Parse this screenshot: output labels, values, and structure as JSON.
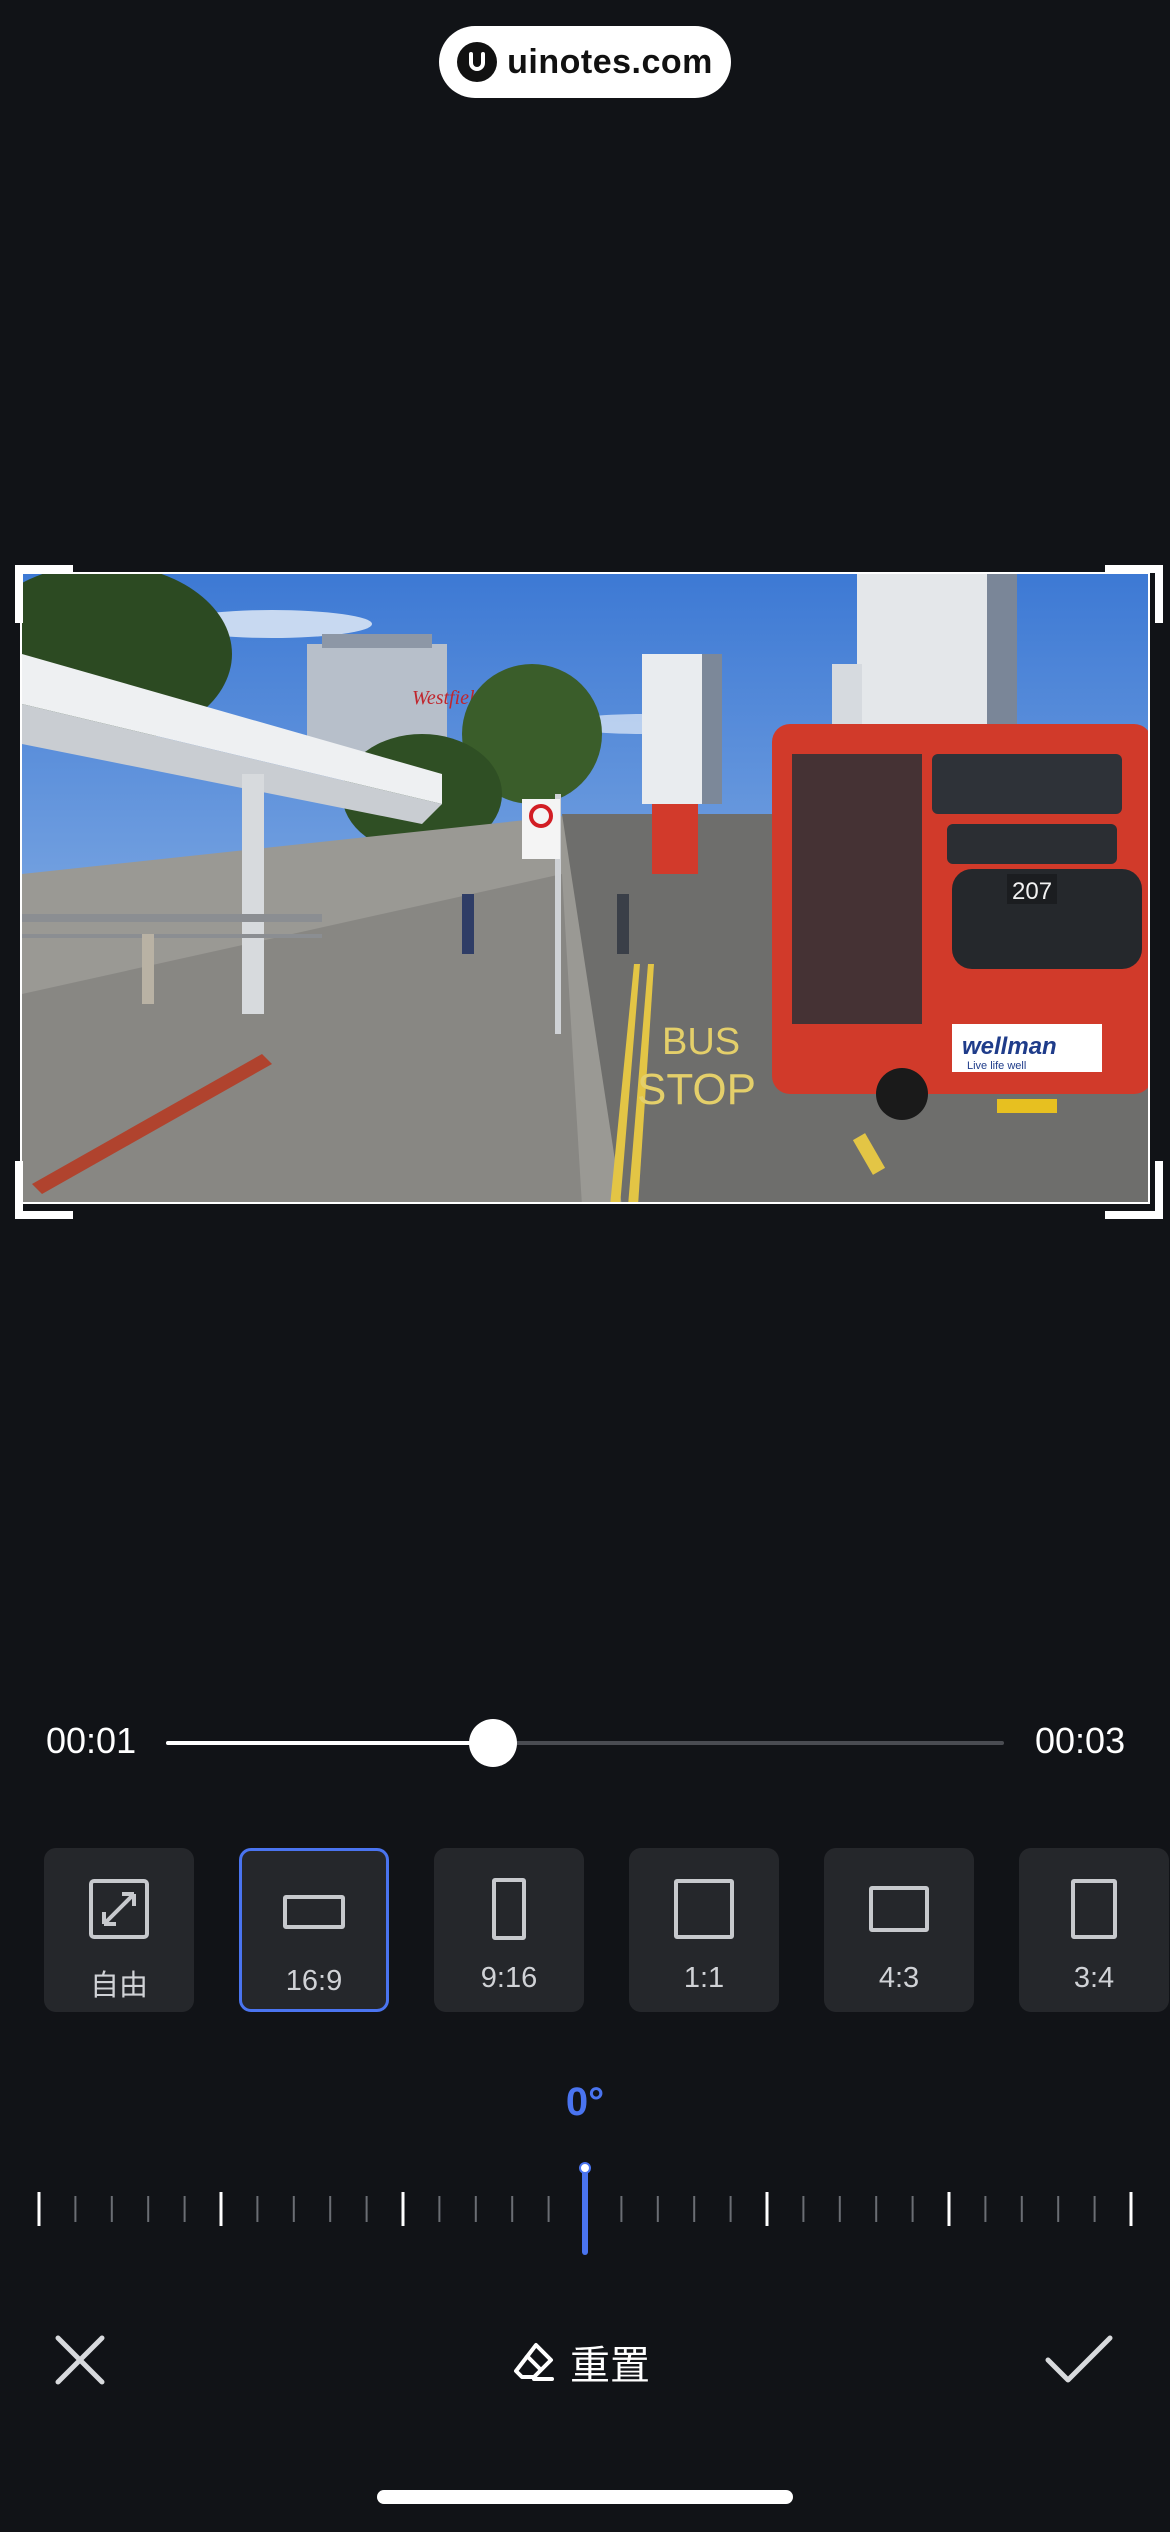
{
  "watermark": {
    "text": "uinotes.com"
  },
  "preview": {
    "bus_route": "207",
    "ad_brand": "wellman",
    "ad_tagline": "Live life well",
    "road_text_1": "BUS",
    "road_text_2": "STOP",
    "building_sign": "Westfield"
  },
  "timeline": {
    "start": "00:01",
    "end": "00:03",
    "progress": 0.39
  },
  "ratios": [
    {
      "label": "自由",
      "icon": "free-crop-icon"
    },
    {
      "label": "16:9",
      "icon": "ratio-16-9-icon",
      "selected": true
    },
    {
      "label": "9:16",
      "icon": "ratio-9-16-icon"
    },
    {
      "label": "1:1",
      "icon": "ratio-1-1-icon"
    },
    {
      "label": "4:3",
      "icon": "ratio-4-3-icon"
    },
    {
      "label": "3:4",
      "icon": "ratio-3-4-icon"
    }
  ],
  "rotation": {
    "angle": "0°"
  },
  "toolbar": {
    "reset_label": "重置",
    "close_icon": "close-icon",
    "confirm_icon": "check-icon",
    "reset_icon": "eraser-icon"
  },
  "colors": {
    "accent": "#4a74f0",
    "background": "#111317",
    "tile": "#25272b"
  }
}
